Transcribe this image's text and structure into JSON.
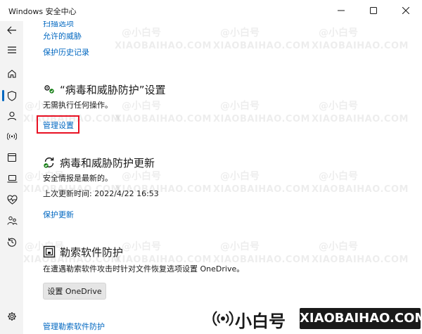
{
  "window": {
    "title": "Windows 安全中心"
  },
  "sidebar": {
    "items": [
      {
        "name": "back-arrow-icon"
      },
      {
        "name": "menu-icon"
      },
      {
        "name": "home-icon"
      },
      {
        "name": "shield-icon",
        "active": true
      },
      {
        "name": "person-icon"
      },
      {
        "name": "wifi-icon"
      },
      {
        "name": "app-browser-icon"
      },
      {
        "name": "laptop-icon"
      },
      {
        "name": "heart-icon"
      },
      {
        "name": "family-icon"
      },
      {
        "name": "history-icon"
      },
      {
        "name": "gear-icon"
      }
    ]
  },
  "top_links": {
    "scan_options": "扫描选项",
    "allowed_threats": "允许的威胁",
    "protection_history": "保护历史记录"
  },
  "settings_section": {
    "heading": "“病毒和威胁防护”设置",
    "status": "无需执行任何操作。",
    "manage_link": "管理设置"
  },
  "updates_section": {
    "heading": "病毒和威胁防护更新",
    "status": "安全情报是最新的。",
    "last_update": "上次更新时间: 2022/4/22 16:53",
    "link": "保护更新"
  },
  "ransomware_section": {
    "heading": "勒索软件防护",
    "description": "在遭遇勒索软件攻击时针对文件恢复选项设置 OneDrive。",
    "button": "设置 OneDrive",
    "link": "管理勒索软件防护"
  },
  "watermark": {
    "brand": "@小白号",
    "site": "XIAOBAIHAO.COM"
  },
  "overlay": {
    "brand": "小白号",
    "site": "XIAOBAIHAO.COM"
  },
  "colors": {
    "accent": "#0067c0",
    "highlight": "#e81123",
    "sidebar_bg": "#f3f3f3"
  }
}
